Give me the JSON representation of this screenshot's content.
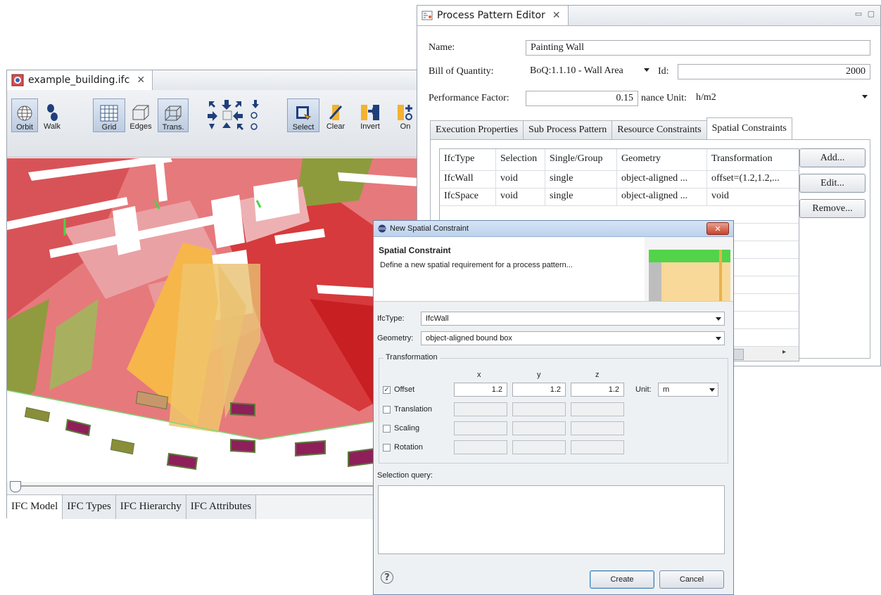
{
  "ifc_viewer": {
    "tab_title": "example_building.ifc",
    "toolbar": {
      "orbit": "Orbit",
      "walk": "Walk",
      "grid": "Grid",
      "edges": "Edges",
      "trans": "Trans.",
      "select": "Select",
      "clear": "Clear",
      "invert": "Invert",
      "on": "On"
    },
    "bottom_tabs": [
      "IFC Model",
      "IFC Types",
      "IFC Hierarchy",
      "IFC Attributes"
    ],
    "colors": {
      "wall_red": "#e0676b",
      "wall_pink": "#e7a3a6",
      "selected_orange": "#f5b640",
      "floor_olive": "#8d9a3a"
    }
  },
  "editor": {
    "tab_title": "Process Pattern Editor",
    "name_label": "Name:",
    "name_value": "Painting Wall",
    "boq_label": "Bill of Quantity:",
    "boq_value": "BoQ:1.1.10 - Wall Area",
    "id_label": "Id:",
    "id_value": "2000",
    "perf_label": "Performance Factor:",
    "perf_value": "0.15",
    "unit_label": "nance Unit:",
    "unit_value": "h/m2",
    "tabs": [
      "Execution Properties",
      "Sub Process Pattern",
      "Resource Constraints",
      "Spatial Constraints"
    ],
    "table": {
      "headers": [
        "IfcType",
        "Selection",
        "Single/Group",
        "Geometry",
        "Transformation"
      ],
      "rows": [
        [
          "IfcWall",
          "void",
          "single",
          "object-aligned ...",
          "offset=(1.2,1.2,..."
        ],
        [
          "IfcSpace",
          "void",
          "single",
          "object-aligned ...",
          "void"
        ]
      ]
    },
    "buttons": {
      "add": "Add...",
      "edit": "Edit...",
      "remove": "Remove..."
    }
  },
  "dialog": {
    "title": "New Spatial Constraint",
    "heading": "Spatial Constraint",
    "description": "Define a new spatial requirement for a process pattern...",
    "ifctype_label": "IfcType:",
    "ifctype_value": "IfcWall",
    "geometry_label": "Geometry:",
    "geometry_value": "object-aligned bound box",
    "transformation_group": "Transformation",
    "axis": {
      "x": "x",
      "y": "y",
      "z": "z"
    },
    "offset_label": "Offset",
    "offset_checked": true,
    "offset_x": "1.2",
    "offset_y": "1.2",
    "offset_z": "1.2",
    "unit_label": "Unit:",
    "unit_value": "m",
    "translation_label": "Translation",
    "scaling_label": "Scaling",
    "rotation_label": "Rotation",
    "selection_query_label": "Selection query:",
    "create": "Create",
    "cancel": "Cancel"
  }
}
